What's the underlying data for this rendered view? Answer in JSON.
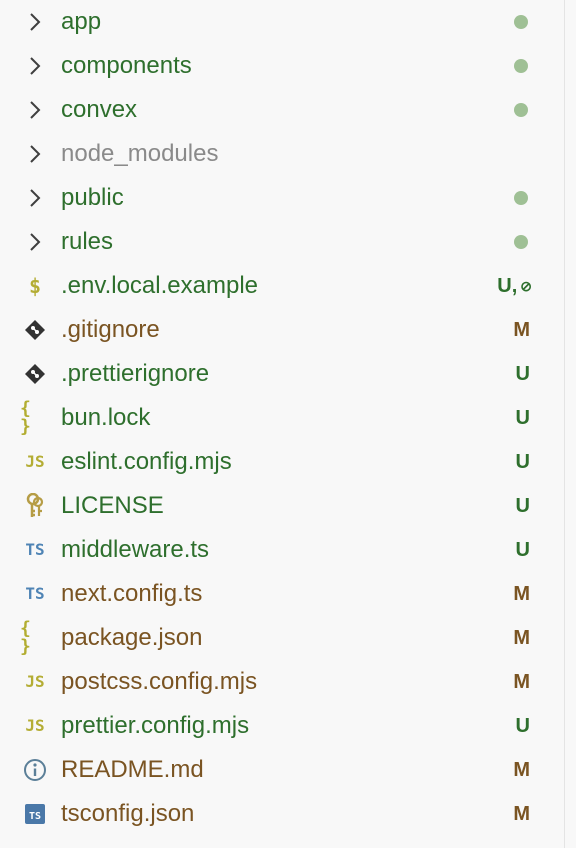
{
  "colors": {
    "added": "#2e6f2d",
    "modified": "#7a5422",
    "ignored": "#8a8a8a",
    "dot": "#9fc095",
    "chevron": "#3f3f3f",
    "js_icon": "#b4ad34",
    "ts_icon": "#4f84b5",
    "json_icon": "#b2ad31",
    "git_icon": "#333333",
    "license_icon": "#b69d46",
    "info_icon": "#5b7f98",
    "tsconfig_icon": "#4a78a8"
  },
  "tree": {
    "folders": [
      {
        "name": "app",
        "status": "modified-dot"
      },
      {
        "name": "components",
        "status": "modified-dot"
      },
      {
        "name": "convex",
        "status": "modified-dot"
      },
      {
        "name": "node_modules",
        "status": "ignored"
      },
      {
        "name": "public",
        "status": "modified-dot"
      },
      {
        "name": "rules",
        "status": "modified-dot"
      }
    ],
    "files": [
      {
        "name": ".env.local.example",
        "icon": "dollar-icon",
        "icon_text": "$",
        "status_text": "U,",
        "status_extra_icon": "ignored-icon",
        "status_extra_text": "⊘"
      },
      {
        "name": ".gitignore",
        "icon": "git-icon",
        "status_text": "M"
      },
      {
        "name": ".prettierignore",
        "icon": "git-icon",
        "status_text": "U"
      },
      {
        "name": "bun.lock",
        "icon": "json-braces-icon",
        "icon_text": "{ }",
        "status_text": "U"
      },
      {
        "name": "eslint.config.mjs",
        "icon": "js-icon",
        "icon_text": "JS",
        "status_text": "U"
      },
      {
        "name": "LICENSE",
        "icon": "license-key-icon",
        "status_text": "U"
      },
      {
        "name": "middleware.ts",
        "icon": "ts-icon",
        "icon_text": "TS",
        "status_text": "U"
      },
      {
        "name": "next.config.ts",
        "icon": "ts-icon",
        "icon_text": "TS",
        "status_text": "M"
      },
      {
        "name": "package.json",
        "icon": "json-braces-icon",
        "icon_text": "{ }",
        "status_text": "M"
      },
      {
        "name": "postcss.config.mjs",
        "icon": "js-icon",
        "icon_text": "JS",
        "status_text": "M"
      },
      {
        "name": "prettier.config.mjs",
        "icon": "js-icon",
        "icon_text": "JS",
        "status_text": "U"
      },
      {
        "name": "README.md",
        "icon": "info-icon",
        "status_text": "M"
      },
      {
        "name": "tsconfig.json",
        "icon": "tsconfig-icon",
        "icon_text": "TS",
        "status_text": "M"
      }
    ]
  }
}
